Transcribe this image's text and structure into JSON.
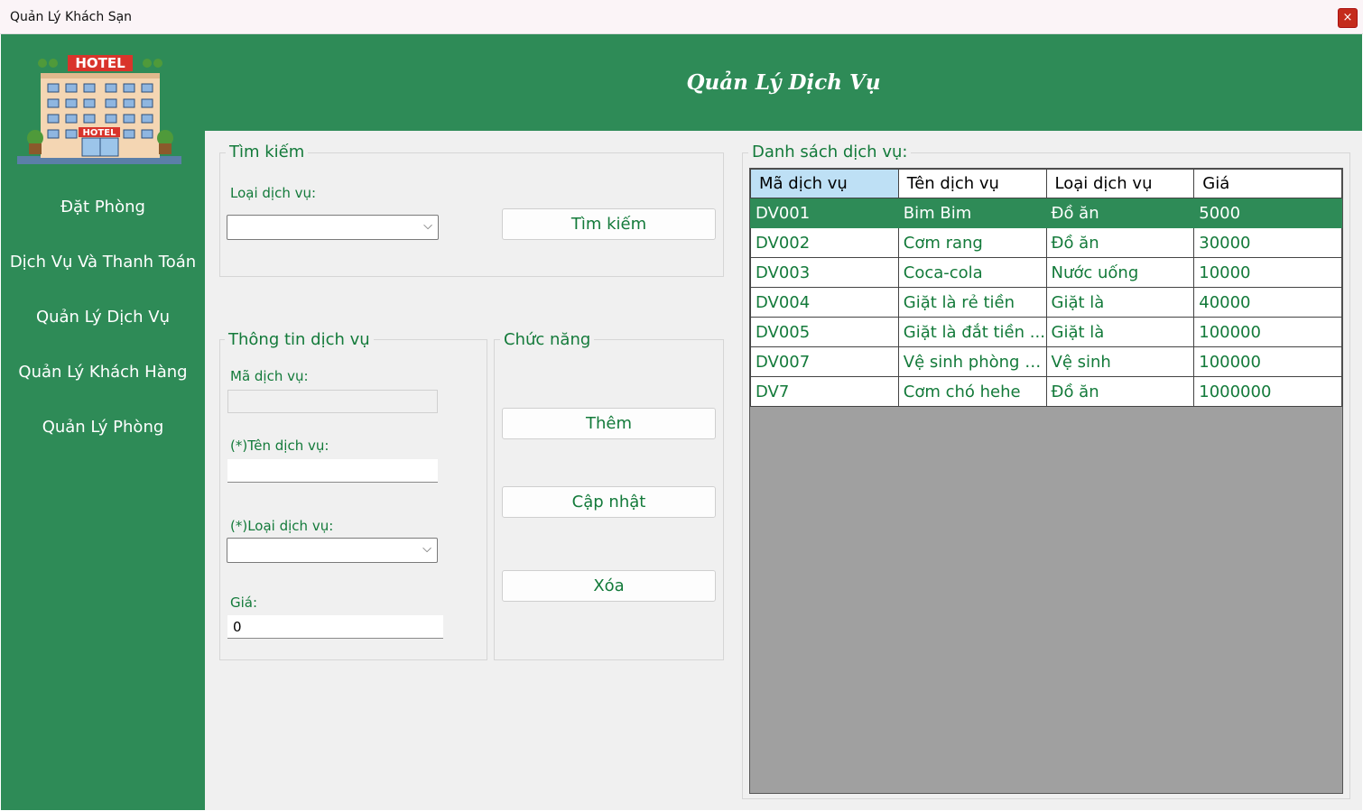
{
  "window": {
    "title": "Quản Lý Khách Sạn",
    "close_glyph": "×"
  },
  "sidebar": {
    "logo_icon": "hotel-building-icon",
    "logo_texts": [
      "HOTEL",
      "HOTEL"
    ],
    "items": [
      {
        "label": "Đặt Phòng"
      },
      {
        "label": "Dịch Vụ Và Thanh Toán"
      },
      {
        "label": "Quản Lý Dịch Vụ"
      },
      {
        "label": "Quản Lý Khách Hàng"
      },
      {
        "label": "Quản Lý Phòng"
      }
    ]
  },
  "header": {
    "title": "Quản Lý Dịch Vụ"
  },
  "search": {
    "group_title": "Tìm kiếm",
    "type_label": "Loại dịch vụ:",
    "type_value": "",
    "button": "Tìm kiếm"
  },
  "info": {
    "group_title": "Thông tin dịch vụ",
    "id_label": "Mã dịch vụ:",
    "id_value": "",
    "name_label": "(*)Tên dịch vụ:",
    "name_value": "",
    "type_label": "(*)Loại dịch vụ:",
    "type_value": "",
    "price_label": "Giá:",
    "price_value": "0"
  },
  "actions": {
    "group_title": "Chức năng",
    "add": "Thêm",
    "update": "Cập nhật",
    "delete": "Xóa"
  },
  "list": {
    "group_title": "Danh sách dịch vụ:",
    "columns": [
      "Mã dịch vụ",
      "Tên dịch vụ",
      "Loại dịch vụ",
      "Giá"
    ],
    "selected_row": 0,
    "rows": [
      [
        "DV001",
        "Bim Bim",
        "Đồ ăn",
        "5000"
      ],
      [
        "DV002",
        "Cơm rang",
        "Đồ ăn",
        "30000"
      ],
      [
        "DV003",
        "Coca-cola",
        "Nước uống",
        "10000"
      ],
      [
        "DV004",
        "Giặt là rẻ tiền",
        "Giặt là",
        "40000"
      ],
      [
        "DV005",
        "Giặt là đắt tiền ...",
        "Giặt là",
        "100000"
      ],
      [
        "DV007",
        "Vệ sinh phòng t...",
        "Vệ sinh",
        "100000"
      ],
      [
        "DV7",
        "Cơm chó hehe",
        "Đồ ăn",
        "1000000"
      ]
    ]
  },
  "colors": {
    "brand_green": "#2e8b57",
    "text_green": "#137a3a",
    "selected_header": "#bee0f5"
  }
}
